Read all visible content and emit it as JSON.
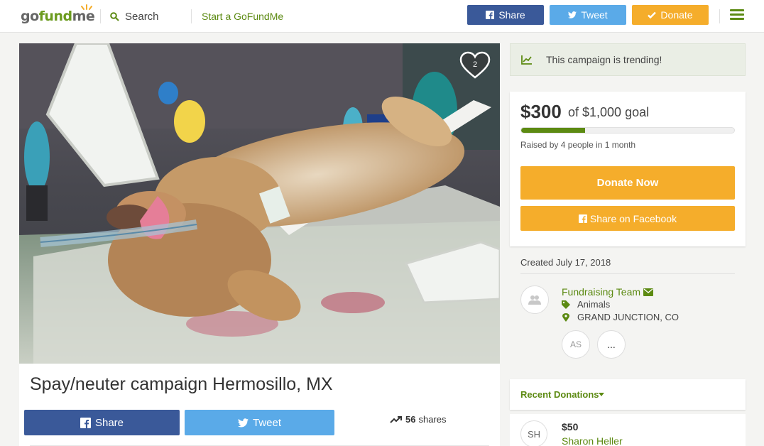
{
  "header": {
    "logo": {
      "go": "go",
      "fund": "fund",
      "me": "me"
    },
    "search_label": "Search",
    "start_label": "Start a GoFundMe",
    "share_label": "Share",
    "tweet_label": "Tweet",
    "donate_label": "Donate",
    "colors": {
      "facebook": "#3a5999",
      "twitter": "#5aaae8",
      "donate": "#f5ad2b",
      "brand": "#5c8a12"
    }
  },
  "campaign": {
    "title": "Spay/neuter campaign Hermosillo, MX",
    "heart_count": "2",
    "share_label": "Share",
    "tweet_label": "Tweet",
    "shares_count": "56",
    "shares_label": "shares"
  },
  "sidebar": {
    "trending_text": "This campaign is trending!",
    "raised_amount": "$300",
    "goal_text": "of $1,000 goal",
    "progress_fraction": 0.3,
    "raised_by": "Raised by 4 people in 1 month",
    "donate_now_label": "Donate Now",
    "share_facebook_label": "Share on Facebook",
    "created": "Created July 17, 2018",
    "team_name": "Fundraising Team",
    "category": "Animals",
    "location": "GRAND JUNCTION, CO",
    "member_initials": "AS",
    "more_label": "...",
    "recent_donations_label": "Recent Donations",
    "donation": {
      "initials": "SH",
      "amount": "$50",
      "name": "Sharon Heller"
    }
  }
}
